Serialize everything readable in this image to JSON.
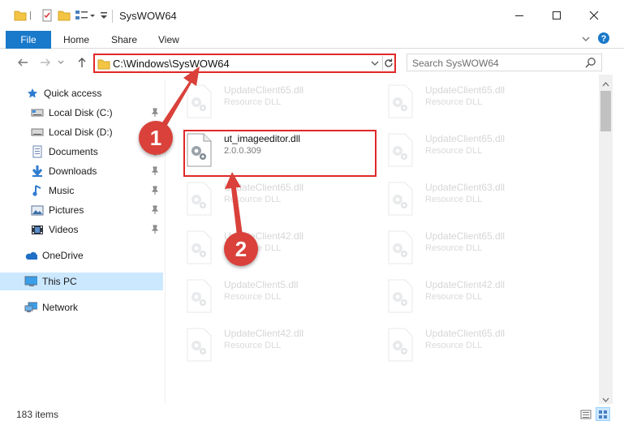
{
  "window": {
    "title": "SysWOW64",
    "minimize_icon": "minimize-icon",
    "maximize_icon": "maximize-icon",
    "close_icon": "close-icon"
  },
  "ribbon": {
    "tabs": [
      "File",
      "Home",
      "Share",
      "View"
    ]
  },
  "address": {
    "path": "C:\\Windows\\SysWOW64"
  },
  "search": {
    "placeholder": "Search SysWOW64"
  },
  "sidebar": {
    "items": [
      {
        "label": "Quick access",
        "icon": "star-icon"
      },
      {
        "label": "Local Disk (C:)",
        "icon": "drive-icon",
        "pinned": true
      },
      {
        "label": "Local Disk (D:)",
        "icon": "drive-icon"
      },
      {
        "label": "Documents",
        "icon": "documents-icon",
        "pinned": true
      },
      {
        "label": "Downloads",
        "icon": "downloads-icon",
        "pinned": true
      },
      {
        "label": "Music",
        "icon": "music-icon",
        "pinned": true
      },
      {
        "label": "Pictures",
        "icon": "pictures-icon",
        "pinned": true
      },
      {
        "label": "Videos",
        "icon": "videos-icon",
        "pinned": true
      },
      {
        "label": "OneDrive",
        "icon": "cloud-icon"
      },
      {
        "label": "This PC",
        "icon": "computer-icon",
        "selected": true
      },
      {
        "label": "Network",
        "icon": "network-icon"
      }
    ]
  },
  "files": {
    "left": [
      {
        "name": "UpdateClient65.dll",
        "desc": "Resource DLL"
      },
      {
        "name": "ut_imageeditor.dll",
        "desc": "2.0.0.309"
      },
      {
        "name": "UpdateClient65.dll",
        "desc": "Resource DLL"
      },
      {
        "name": "UpdateClient42.dll",
        "desc": "Resource DLL"
      },
      {
        "name": "UpdateClient5.dll",
        "desc": "Resource DLL"
      },
      {
        "name": "UpdateClient42.dll",
        "desc": "Resource DLL"
      }
    ],
    "right": [
      {
        "name": "UpdateClient65.dll",
        "desc": "Resource DLL"
      },
      {
        "name": "UpdateClient65.dll",
        "desc": "Resource DLL"
      },
      {
        "name": "UpdateClient63.dll",
        "desc": "Resource DLL"
      },
      {
        "name": "UpdateClient65.dll",
        "desc": "Resource DLL"
      },
      {
        "name": "UpdateClient42.dll",
        "desc": "Resource DLL"
      },
      {
        "name": "UpdateClient65.dll",
        "desc": "Resource DLL"
      }
    ]
  },
  "status": {
    "count": "183 items"
  },
  "annotations": {
    "step1": "1",
    "step2": "2",
    "color": "#d9413a"
  }
}
